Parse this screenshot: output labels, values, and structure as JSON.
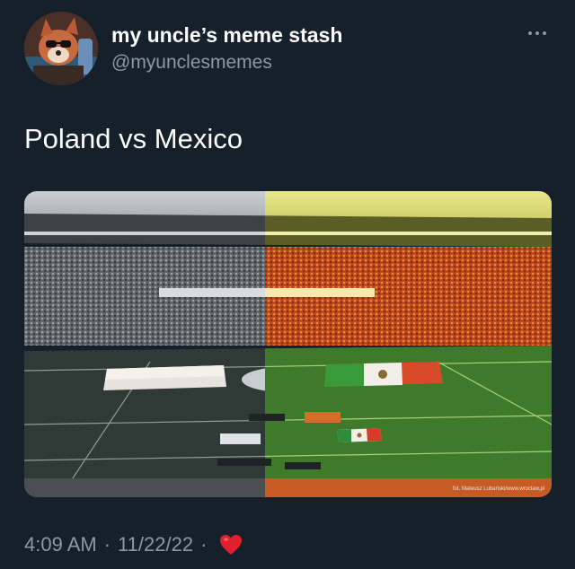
{
  "tweet": {
    "author": {
      "display_name": "my uncle’s meme stash",
      "handle": "@myunclesmemes",
      "avatar_icon": "raccoon-avatar"
    },
    "text": "Poland vs Mexico",
    "media": {
      "credit": "fot. Mateusz Lubański/www.wroclaw.pl"
    },
    "time": "4:09 AM",
    "date": "11/22/22",
    "separator": "·",
    "reaction_icon": "red-heart-emoji"
  },
  "colors": {
    "background": "#15202b",
    "secondary_text": "#8b98a5",
    "heart": "#e0245e"
  }
}
